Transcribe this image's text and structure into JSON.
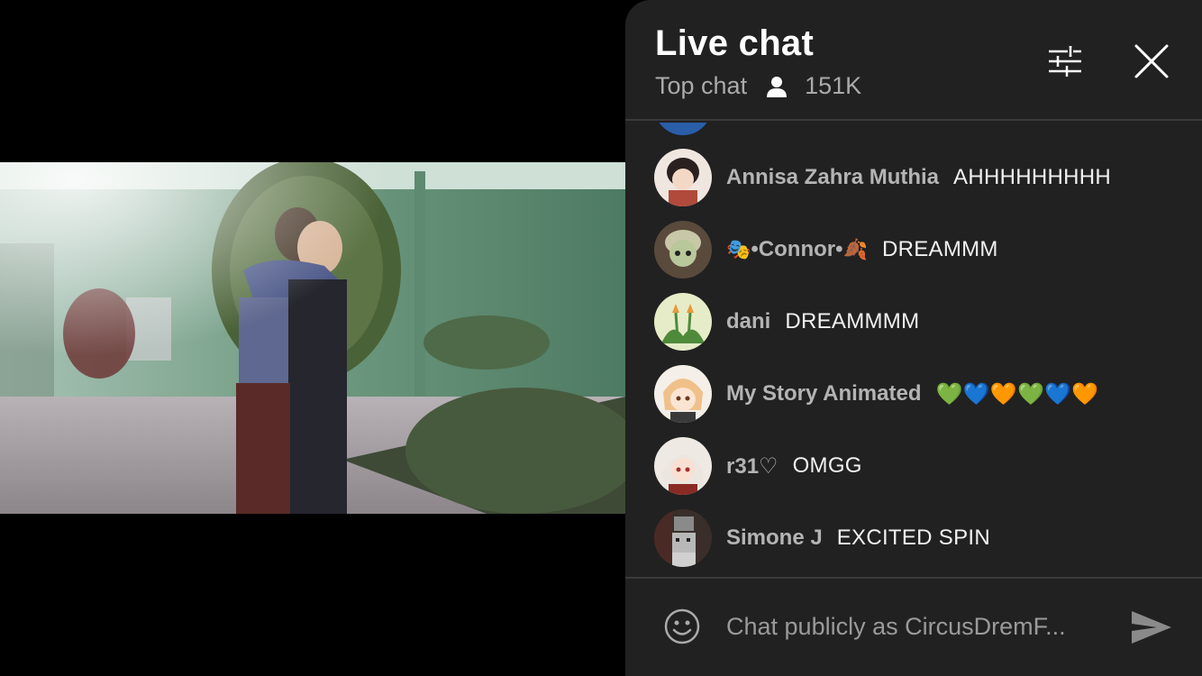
{
  "video": {
    "scene": "video-frame"
  },
  "chat": {
    "title": "Live chat",
    "mode": "Top chat",
    "viewer_count": "151K",
    "input_placeholder": "Chat publicly as CircusDremF...",
    "messages": [
      {
        "author": "Annisa Zahra Muthia",
        "text": "AHHHHHHHHH"
      },
      {
        "author": "•Connor•",
        "author_prefix_emoji": "🎭",
        "author_suffix_emoji": "🍂",
        "text": "DREAMMM"
      },
      {
        "author": "dani",
        "text": "DREAMMMM"
      },
      {
        "author": "My Story Animated",
        "text": "💚💙🧡💚💙🧡"
      },
      {
        "author": "r31♡",
        "text": "OMGG"
      },
      {
        "author": "Simone J",
        "text": "EXCITED SPIN"
      }
    ]
  },
  "colors": {
    "panel_bg": "#212121",
    "divider": "#3a3a3a",
    "author": "#b4b4b4",
    "message": "#f1f1f1",
    "secondary": "#aaaaaa"
  },
  "icons": [
    "person-icon",
    "tune-icon",
    "close-icon",
    "emoji-icon",
    "send-icon"
  ]
}
